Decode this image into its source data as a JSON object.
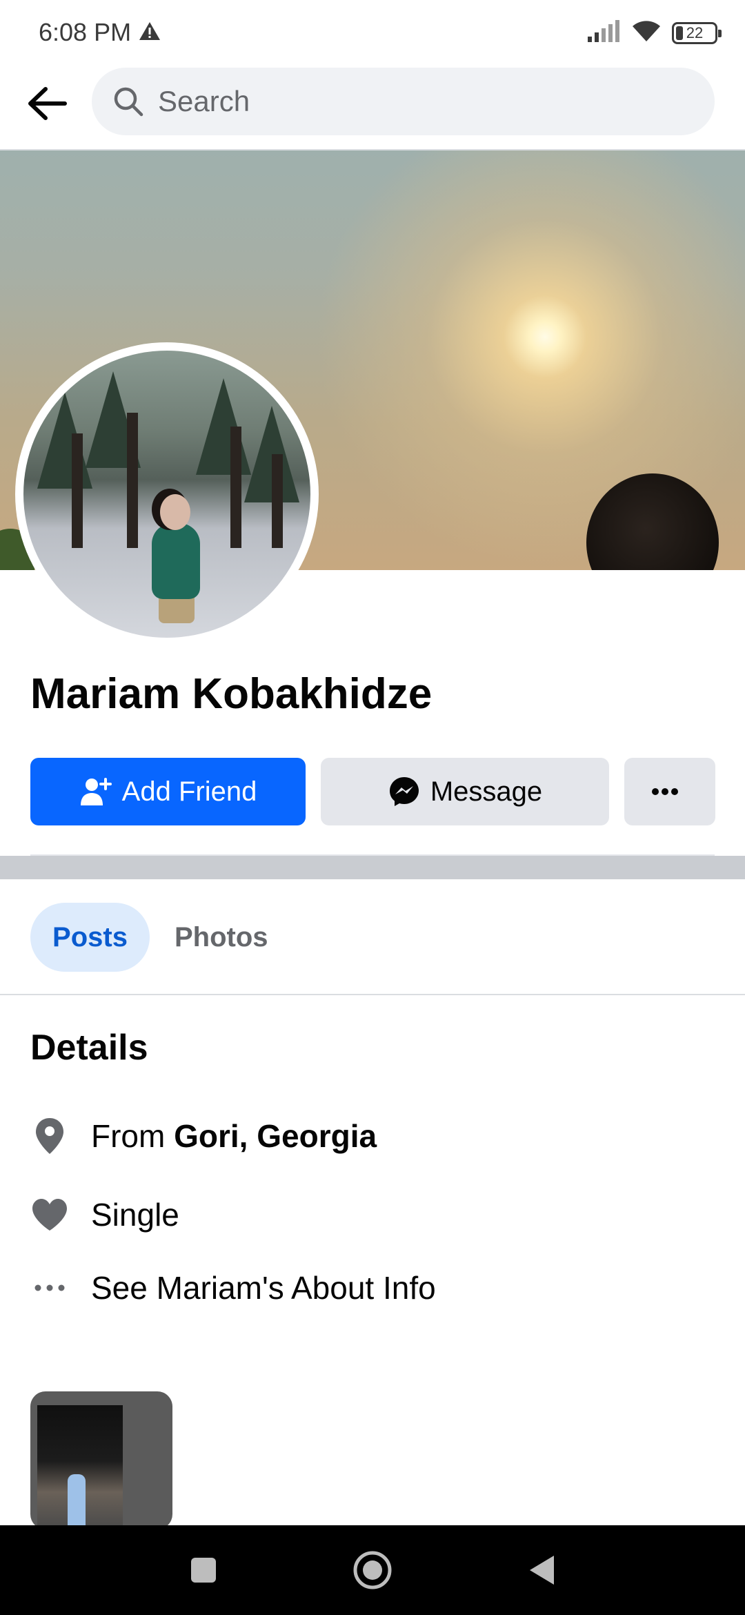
{
  "status_bar": {
    "time": "6:08 PM",
    "battery": "22",
    "icons": [
      "warning-icon",
      "signal-icon",
      "wifi-icon",
      "battery-icon"
    ]
  },
  "top_bar": {
    "back_icon": "arrow-left-icon",
    "search_placeholder": "Search"
  },
  "profile": {
    "name": "Mariam Kobakhidze"
  },
  "actions": {
    "add_friend_label": "Add Friend",
    "message_label": "Message",
    "more_label": "···"
  },
  "tabs": [
    {
      "label": "Posts",
      "selected": true
    },
    {
      "label": "Photos",
      "selected": false
    }
  ],
  "details": {
    "title": "Details",
    "from_prefix": "From",
    "from_value": "Gori, Georgia",
    "relationship": "Single",
    "about_link": "See Mariam's About Info"
  },
  "colors": {
    "primary": "#0866ff",
    "tab_selected_bg": "#ddebfc",
    "tab_selected_text": "#0a5bcf",
    "secondary_button": "#e4e6eb",
    "icon_gray": "#65676b"
  },
  "nav_bar": {
    "buttons": [
      "recents-square-icon",
      "home-circle-icon",
      "back-triangle-icon"
    ]
  }
}
